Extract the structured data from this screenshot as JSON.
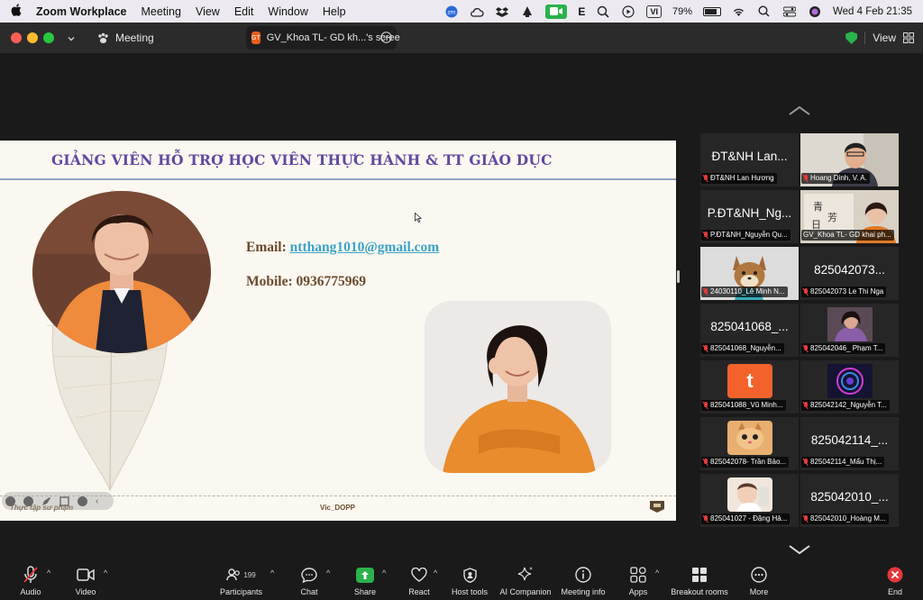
{
  "menubar": {
    "app_name": "Zoom Workplace",
    "items": [
      "Meeting",
      "View",
      "Edit",
      "Window",
      "Help"
    ],
    "battery": "79%",
    "datetime": "Wed 4 Feb  21:35",
    "input_source": "VI",
    "e_label": "E"
  },
  "window": {
    "tab_meeting": "Meeting",
    "tab_share": "GV_Khoa TL- GD kh...'s scree",
    "tab_share_badge": "GT",
    "view_label": "View"
  },
  "slide": {
    "title": "GIẢNG VIÊN HỖ TRỢ HỌC VIÊN THỰC HÀNH & TT GIÁO DỤC",
    "email_label": "Email: ",
    "email": "ntthang1010@gmail.com",
    "mobile": "Mobile: 0936775969",
    "footer_left": "Thực tập sư phạm",
    "footer_center": "Vic_DOPP"
  },
  "gallery": [
    {
      "big": "ĐT&NH Lan...",
      "label": "ĐT&NH Lan Hương",
      "muted": true
    },
    {
      "big": "",
      "label": "Hoang Dinh, V. A.",
      "muted": true
    },
    {
      "big": "P.ĐT&NH_Ng...",
      "label": "P.ĐT&NH_Nguyễn Qu...",
      "muted": true
    },
    {
      "big": "",
      "label": "GV_Khoa TL- GD khai ph...",
      "muted": false
    },
    {
      "big": "",
      "label": "24030110_Lê Minh N...",
      "muted": true
    },
    {
      "big": "825042073...",
      "label": "825042073 Le Thi Nga",
      "muted": true
    },
    {
      "big": "825041068_...",
      "label": "825041068_Nguyễn...",
      "muted": true
    },
    {
      "big": "",
      "label": "825042046_ Phạm T...",
      "muted": true
    },
    {
      "big": "",
      "label": "825041088_Vũ  Minh...",
      "muted": true
    },
    {
      "big": "",
      "label": "825042142_Nguyễn T...",
      "muted": true
    },
    {
      "big": "",
      "label": "825042078- Trần Bảo...",
      "muted": true
    },
    {
      "big": "825042114_...",
      "label": "825042114_Mẩu Thị...",
      "muted": true
    },
    {
      "big": "",
      "label": "825041027 - Đặng Hả...",
      "muted": true
    },
    {
      "big": "825042010_...",
      "label": "825042010_Hoàng M...",
      "muted": true
    }
  ],
  "avatar_letter_t": "t",
  "toolbar": {
    "audio": "Audio",
    "video": "Video",
    "participants": "Participants",
    "participants_count": "199",
    "chat": "Chat",
    "share": "Share",
    "react": "React",
    "host_tools": "Host tools",
    "ai_companion": "AI Companion",
    "meeting_info": "Meeting info",
    "apps": "Apps",
    "breakout_rooms": "Breakout rooms",
    "more": "More",
    "end": "End"
  },
  "colors": {
    "zoom_green": "#2bb24c",
    "end_red": "#e5383b",
    "title_purple": "#5e4aa0",
    "slide_brown": "#6b4a2c",
    "link_blue": "#3aa3c8"
  }
}
